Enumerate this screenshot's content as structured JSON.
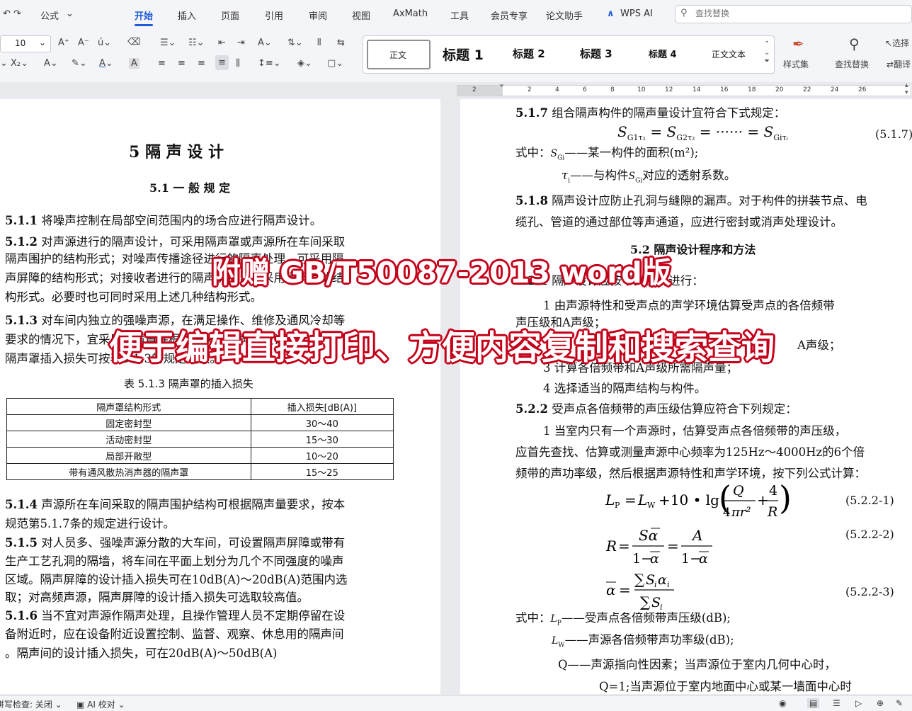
{
  "menu": {
    "undo_redo": "↶ ↷",
    "formula": "公式",
    "tabs": [
      "开始",
      "插入",
      "页面",
      "引用",
      "审阅",
      "视图",
      "AxMath",
      "工具",
      "会员专享",
      "论文助手",
      "WPS AI"
    ],
    "search_placeholder": "查找替换"
  },
  "toolbar": {
    "font_size": "10",
    "styles": [
      "正文",
      "标题 1",
      "标题 2",
      "标题 3",
      "标题 4",
      "正文文本"
    ],
    "style_set": "样式集",
    "find_replace": "查找替换",
    "select": "选择",
    "translate": "翻译"
  },
  "ruler": {
    "ticks": [
      "2",
      "2",
      "4",
      "6",
      "8",
      "10",
      "12",
      "14",
      "16",
      "18",
      "20",
      "22",
      "24",
      "26"
    ]
  },
  "left_page": {
    "chapter_title": "5 隔 声 设 计",
    "section_title": "5.1 一 般 规 定",
    "lines": [
      {
        "num": "5.1.1",
        "text": "将噪声控制在局部空间范围内的场合应进行隔声设计。"
      },
      {
        "num": "5.1.2",
        "text": "对声源进行的隔声设计，可采用隔声罩或声源所在车间采取"
      },
      {
        "num": "",
        "text": "隔声围护的结构形式；对噪声传播途径进行的隔声处理，可采用隔"
      },
      {
        "num": "",
        "text": "声屏障的结构形式；对接收者进行的隔声防护，可采用隔声间的结"
      },
      {
        "num": "",
        "text": "构形式。必要时也可同时采用上述几种结构形式。"
      },
      {
        "num": "5.1.3",
        "text": "对车间内独立的强噪声源，在满足操作、维修及通风冷却等"
      },
      {
        "num": "",
        "text": "要求的情况下，宜采用隔声罩并根据所需的隔声量设计，"
      },
      {
        "num": "",
        "text": "隔声罩插入损失可按表5.1.3的规定选取。"
      }
    ],
    "table_caption": "表 5.1.3  隔声罩的插入损失",
    "table_headers": [
      "隔声罩结构形式",
      "插入损失[dB(A)]"
    ],
    "table_rows": [
      [
        "固定密封型",
        "30～40"
      ],
      [
        "活动密封型",
        "15～30"
      ],
      [
        "局部开敞型",
        "10～20"
      ],
      [
        "带有通风散热消声器的隔声罩",
        "15～25"
      ]
    ],
    "lines2": [
      {
        "num": "5.1.4",
        "text": "声源所在车间采取的隔声围护结构可根据隔声量要求，按本"
      },
      {
        "num": "",
        "text": "规范第5.1.7条的规定进行设计。"
      },
      {
        "num": "5.1.5",
        "text": "对人员多、强噪声源分散的大车间，可设置隔声屏障或带有"
      },
      {
        "num": "",
        "text": "生产工艺孔洞的隔墙，将车间在平面上划分为几个不同强度的噪声"
      },
      {
        "num": "",
        "text": "区域。隔声屏障的设计插入损失可在10dB(A)～20dB(A)范围内选"
      },
      {
        "num": "",
        "text": "取；对高频声源，隔声屏障的设计插入损失可选取较高值。"
      },
      {
        "num": "5.1.6",
        "text": "当不宜对声源作隔声处理，且操作管理人员不定期停留在设"
      },
      {
        "num": "",
        "text": "备附近时，应在设备附近设置控制、监督、观察、休息用的隔声间"
      },
      {
        "num": "",
        "text": "。隔声间的设计插入损失，可在20dB(A)～50dB(A)"
      }
    ]
  },
  "right_page": {
    "l1_num": "5.1.7",
    "l1": "组合隔声构件的隔声量设计宜符合下式规定：",
    "eq1_no": "(5.1.7)",
    "where1": "式中：",
    "where1a": "——某一构件的面积(m²);",
    "where1b": "——与构件",
    "where1c": "对应的透射系数。",
    "l2_num": "5.1.8",
    "l2": "隔声设计应防止孔洞与缝隙的漏声。对于构件的拼装节点、电",
    "l3": "缆孔、管道的通过部位等声通道，应进行密封或消声处理设计。",
    "section2": "5.2  隔声设计程序和方法",
    "l4_num": "5.2.1",
    "l4": "隔声设计应按下列步骤进行：",
    "s1": "1 由声源特性和受声点的声学环境估算受声点的各倍频带",
    "s1b": "声压级和A声级；",
    "s2": "A声级；",
    "s3": "3 计算各倍频带和A声级所需隔声量；",
    "s4": "4 选择适当的隔声结构与构件。",
    "l5_num": "5.2.2",
    "l5": "受声点各倍频带的声压级估算应符合下列规定：",
    "p1": "1 当室内只有一个声源时，估算受声点各倍频带的声压级，",
    "p2": "应首先查找、估算或测量声源中心频率为125Hz～4000Hz的6个倍",
    "p3": "频带的声功率级，然后根据声源特性和声学环境，按下列公式计算：",
    "eq2_no": "(5.2.2-1)",
    "eq3_no": "(5.2.2-2)",
    "eq4_no": "(5.2.2-3)",
    "w2": "式中：",
    "w2a": "——受声点各倍频带声压级(dB);",
    "w2b": "——声源各倍频带声功率级(dB);",
    "w2c": "Q——声源指向性因素；当声源位于室内几何中心时，",
    "w2d": "Q=1;当声源位于室内地面中心或某一墙面中心时"
  },
  "overlay": {
    "line1": "附赠 GB/T50087-2013 word版",
    "line2": "便于编辑直接打印、方便内容复制和搜索查询"
  },
  "status": {
    "spell_check": "拼写检查: 关闭",
    "ai_check": "AI 校对"
  },
  "colors": {
    "accent": "#1e5bd6",
    "overlay_outline": "#c4001a"
  }
}
